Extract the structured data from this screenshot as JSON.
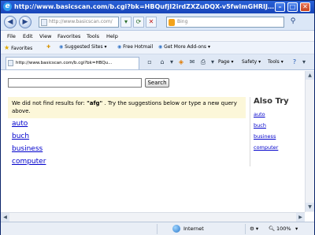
{
  "window": {
    "title": "http://www.basicscan.com/b.cgi?bk=HBQufjI2irdZXZuDQX-v5fwlmGHRIJ6WoS4VoD29..."
  },
  "address_bar": {
    "url": "http://www.basicscan.com/",
    "search_placeholder": "Bing"
  },
  "menu": [
    "File",
    "Edit",
    "View",
    "Favorites",
    "Tools",
    "Help"
  ],
  "favorites_bar": {
    "favorites_label": "Favorites",
    "items": [
      "Suggested Sites",
      "Free Hotmail",
      "Get More Add-ons"
    ]
  },
  "tab": {
    "title": "http://www.basicscan.com/b.cgi?bk=HBQu..."
  },
  "command_bar": {
    "page": "Page",
    "safety": "Safety",
    "tools": "Tools"
  },
  "page": {
    "search_button": "Search",
    "search_value": "",
    "notice_prefix": "We did not find results for: ",
    "query": "\"afg\"",
    "notice_suffix": " . Try the suggestions below or type a new query above.",
    "suggestions": [
      "auto",
      "buch",
      "business",
      "computer"
    ],
    "also_try_title": "Also Try",
    "also_try": [
      "auto",
      "buch",
      "business",
      "computer"
    ]
  },
  "status_bar": {
    "zone": "Internet",
    "zoom": "100%"
  }
}
